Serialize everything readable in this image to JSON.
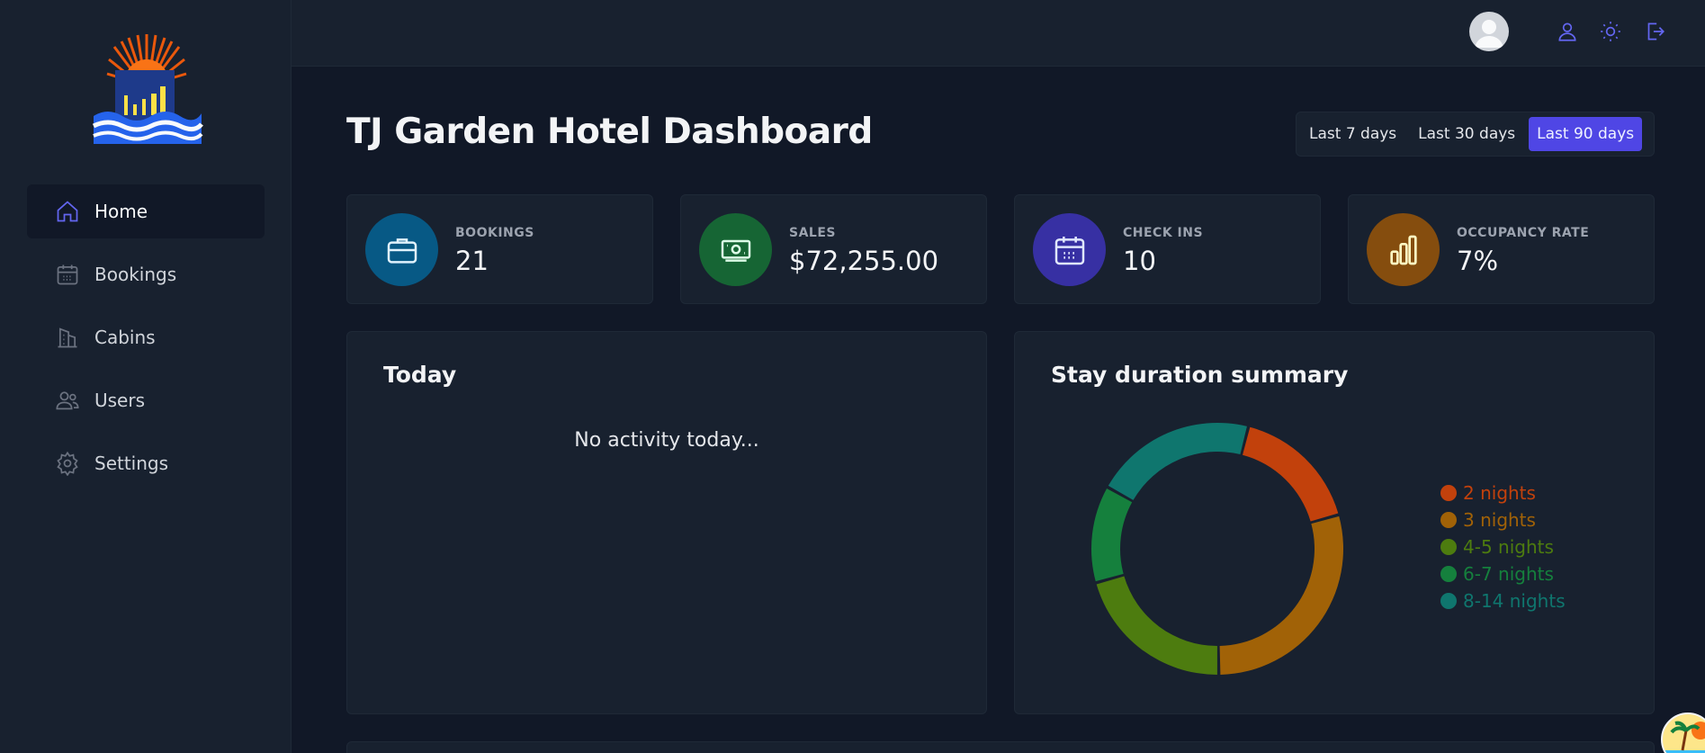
{
  "app": {
    "logo_icon": "hotel-sunrise-logo"
  },
  "sidebar": {
    "items": [
      {
        "label": "Home",
        "icon": "home-icon",
        "active": true
      },
      {
        "label": "Bookings",
        "icon": "calendar-icon",
        "active": false
      },
      {
        "label": "Cabins",
        "icon": "building-icon",
        "active": false
      },
      {
        "label": "Users",
        "icon": "users-icon",
        "active": false
      },
      {
        "label": "Settings",
        "icon": "gear-icon",
        "active": false
      }
    ]
  },
  "header": {
    "icons": [
      "avatar",
      "user-icon",
      "sun-icon",
      "logout-icon"
    ]
  },
  "main": {
    "title": "TJ Garden Hotel Dashboard",
    "filters": [
      {
        "label": "Last 7 days",
        "active": false
      },
      {
        "label": "Last 30 days",
        "active": false
      },
      {
        "label": "Last 90 days",
        "active": true
      }
    ],
    "stats": [
      {
        "label": "BOOKINGS",
        "value": "21",
        "icon": "briefcase-icon",
        "color": "#075985"
      },
      {
        "label": "SALES",
        "value": "$72,255.00",
        "icon": "banknotes-icon",
        "color": "#166534"
      },
      {
        "label": "CHECK INS",
        "value": "10",
        "icon": "calendar-days-icon",
        "color": "#3730a3"
      },
      {
        "label": "OCCUPANCY RATE",
        "value": "7%",
        "icon": "chart-bar-icon",
        "color": "#854d0e"
      }
    ],
    "today": {
      "title": "Today",
      "empty_text": "No activity today..."
    },
    "duration": {
      "title": "Stay duration summary"
    }
  },
  "chart_data": {
    "type": "pie",
    "categories": [
      "2 nights",
      "3 nights",
      "4-5 nights",
      "6-7 nights",
      "8-14 nights"
    ],
    "values": [
      4,
      7,
      5,
      3,
      5
    ],
    "colors": [
      "#c2410c",
      "#a16207",
      "#4d7c0f",
      "#15803d",
      "#0f766e"
    ],
    "legend": "right"
  }
}
